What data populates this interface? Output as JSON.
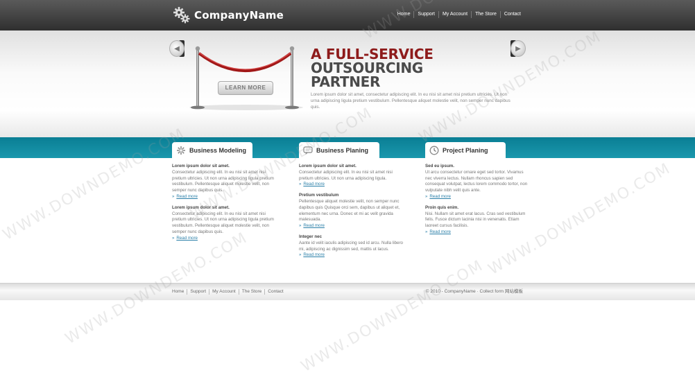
{
  "header": {
    "logo_text": "CompanyName",
    "logo_icon": "gears-icon",
    "nav": [
      "Home",
      "Support",
      "My Account",
      "The Store",
      "Contact"
    ]
  },
  "hero": {
    "title_line1": "A FULL-SERVICE",
    "title_line2": "OUTSOURCING",
    "title_line3": "PARTNER",
    "body": "Lorem ipsum dolor sit amet, consectetur adipiscing elit. In eu nisi sit amet nisi pretium ultricies. Ut non urna adipiscing ligula pretium vestibulum. Pellentesque aliquet molestie velit, non semper nunc dapibus quis.",
    "button_label": "LEARN MORE",
    "prev_icon": "chevron-left-icon",
    "next_icon": "chevron-right-icon",
    "title_color": "#8e1b1b"
  },
  "services": [
    {
      "title": "Business Modeling",
      "icon": "gear-icon",
      "items": [
        {
          "title": "Lorem ipsum dolor sit amet.",
          "text": "Consectetur adipiscing elit. In eu nisi sit amet nisi pretium ultricies. Ut non urna adipiscing ligula pretium vestibulum. Pellentesque aliquet molestie velit, non semper nunc dapibus quis.",
          "link": "Read more"
        },
        {
          "title": "Lorem ipsum dolor sit amet.",
          "text": "Consectetur adipiscing elit. In eu nisi sit amet nisi pretium ultricies. Ut non urna adipiscing ligula pretium vestibulum. Pellentesque aliquet molestie velit, non semper nunc dapibus quis.",
          "link": "Read more"
        }
      ]
    },
    {
      "title": "Business Planing",
      "icon": "speech-bubble-icon",
      "items": [
        {
          "title": "Lorem ipsum dolor sit amet.",
          "text": "Consectetur adipiscing elit. In eu nisi sit amet nisi pretium ultricies. Ut non urna adipiscing ligula.",
          "link": "Read more"
        },
        {
          "title": "Pretium vestibulum",
          "text": "Pellentesque aliquet molestie velit, non semper nunc dapibus quis Quisque orci sem, dapibus ut aliquet et, elementum nec urna. Donec et mi ac velit gravida malesuada.",
          "link": "Read more"
        },
        {
          "title": "Integer nec",
          "text": "Aante id velit iaculis adipiscing sed id arcu. Nulla libero mi, adipiscing ac dignissim sed, mattis ut lacus.",
          "link": "Read more"
        }
      ]
    },
    {
      "title": "Project Planing",
      "icon": "clock-icon",
      "items": [
        {
          "title": "Sed eu ipsum.",
          "text": "Ut arcu consectetur ornare eget sed tortor. Vivamus nec viverra lectus. Nullam rhoncus sapien sed consequat volutpat, lectus lorem commodo tortor, non vulputate nibh velit quis ante.",
          "link": "Read more"
        },
        {
          "title": "Proin quis enim.",
          "text": "Nisi. Nullam sit amet erat lacus. Cras sed vestibulum felis. Fusce dictum lacinia nisi in venenatis. Etiam laoreet cursus facilisis.",
          "link": "Read more"
        }
      ]
    }
  ],
  "footer": {
    "nav": [
      "Home",
      "Support",
      "My Account",
      "The Store",
      "Contact"
    ],
    "copyright": "© 2010 - CompanyName · Collect form 网站模板"
  },
  "watermark": "WWW.DOWNDEMO.COM",
  "colors": {
    "header": "#3d3d3d",
    "band": "#1a8ea4",
    "link": "#2a7fa8"
  }
}
